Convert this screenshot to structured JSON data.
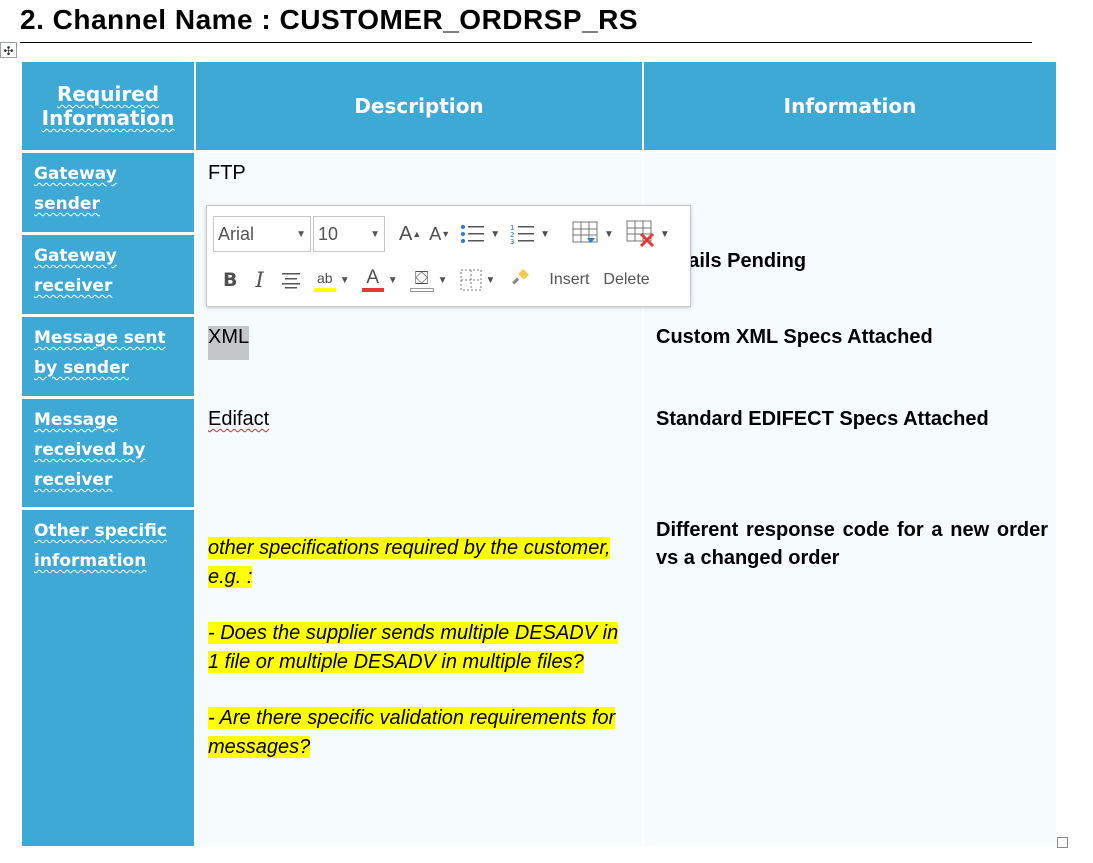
{
  "document": {
    "heading": "2. Channel Name : CUSTOMER_ORDRSP_RS",
    "move_handle_glyph": "✣"
  },
  "table": {
    "headers": [
      "Required Information",
      "Description",
      "Information"
    ],
    "rows": [
      {
        "label": "Gateway sender",
        "description": "FTP",
        "information": ""
      },
      {
        "label": "Gateway receiver",
        "description": "",
        "information": "Details Pending"
      },
      {
        "label": "Message sent by sender",
        "description": "XML",
        "information": "Custom XML Specs Attached"
      },
      {
        "label": "Message received by receiver",
        "description": "Edifact",
        "information": "Standard EDIFECT Specs Attached"
      },
      {
        "label": "Other specific information",
        "description_notes": [
          "other specifications required by the customer, e.g. :",
          "- Does the supplier sends multiple DESADV in 1 file or multiple DESADV in multiple files?",
          "- Are there specific validation requirements for messages?"
        ],
        "information": "Different response code for a new order vs a changed order"
      }
    ]
  },
  "mini_toolbar": {
    "font_name": "Arial",
    "font_size": "10",
    "insert_label": "Insert",
    "delete_label": "Delete",
    "icons": [
      "grow-font-icon",
      "shrink-font-icon",
      "bullets-icon",
      "numbering-icon",
      "insert-table-icon",
      "delete-table-icon",
      "bold-icon",
      "italic-icon",
      "center-icon",
      "highlight-icon",
      "font-color-icon",
      "shading-icon",
      "borders-icon",
      "format-painter-icon"
    ],
    "colors": {
      "highlight": "#ffff00",
      "font_color": "#e53935",
      "delete_x": "#e53935"
    }
  },
  "colors": {
    "header_blue": "#3fa9d6",
    "highlight": "#ffff00",
    "selection": "#c4c7ca"
  }
}
